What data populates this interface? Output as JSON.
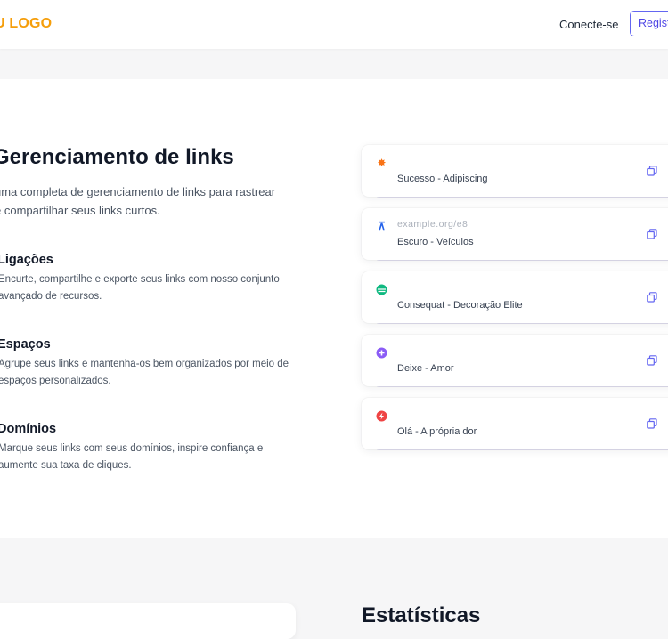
{
  "header": {
    "logo": "U LOGO",
    "login_label": "Conecte-se",
    "register_label": "Registrar"
  },
  "hero": {
    "title": "Gerenciamento de links",
    "subtitle": "uma completa de gerenciamento de links para rastrear e compartilhar seus links curtos."
  },
  "features": [
    {
      "title": "Ligações",
      "description": "Encurte, compartilhe e exporte seus links com nosso conjunto avançado de recursos."
    },
    {
      "title": "Espaços",
      "description": "Agrupe seus links e mantenha-os bem organizados por meio de espaços personalizados."
    },
    {
      "title": "Domínios",
      "description": "Marque seus links com seus domínios, inspire confiança e aumente sua taxa de cliques."
    }
  ],
  "links": [
    {
      "url": "",
      "label": "Sucesso - Adipiscing",
      "icon": "orange-burst-icon",
      "color": "#f97316"
    },
    {
      "url": "example.org/e8",
      "label": "Escuro - Veículos",
      "icon": "blue-brand-icon",
      "color": "#2563eb"
    },
    {
      "url": "",
      "label": "Consequat - Decoração Elite",
      "icon": "green-leaf-icon",
      "color": "#10b981"
    },
    {
      "url": "",
      "label": "Deixe - Amor",
      "icon": "purple-plus-icon",
      "color": "#8b5cf6"
    },
    {
      "url": "",
      "label": "Olá - A própria dor",
      "icon": "red-bolt-icon",
      "color": "#ef4444"
    }
  ],
  "stats": {
    "title": "Estatísticas"
  },
  "colors": {
    "accent": "#6366f1",
    "logo": "#f59e0b",
    "copy_icon": "#6366f1"
  }
}
